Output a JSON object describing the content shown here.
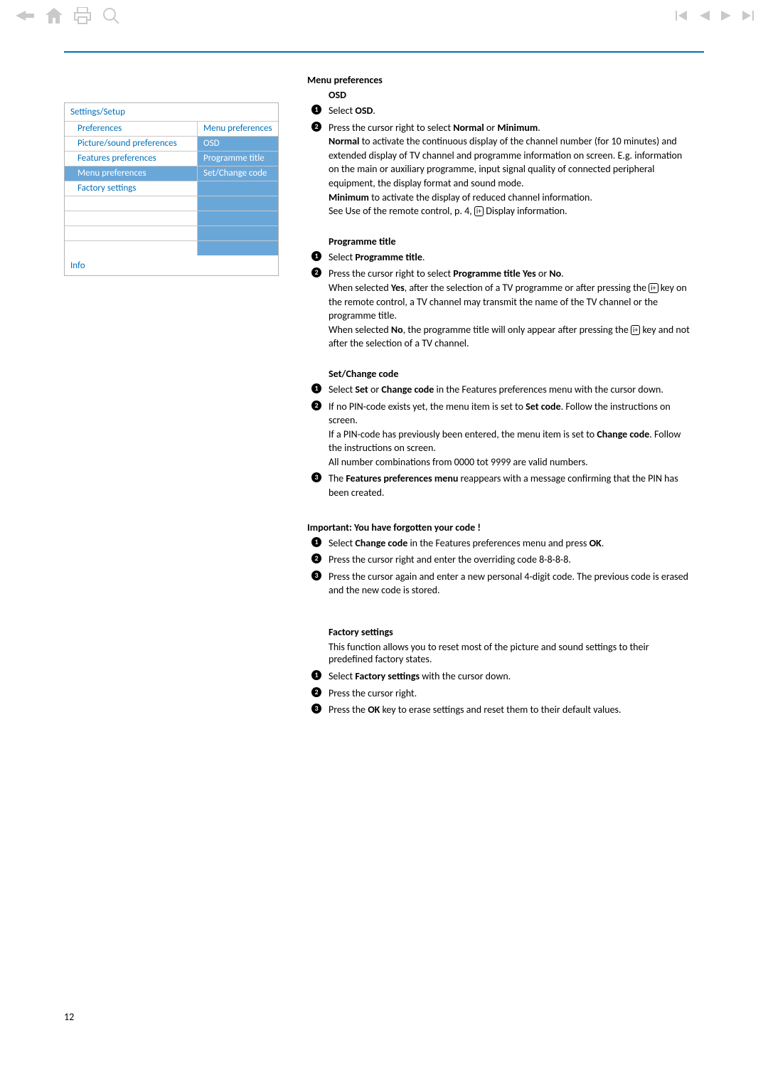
{
  "page_number": "12",
  "menu": {
    "title": "Settings/Setup",
    "col_l_header": "Preferences",
    "col_r_header": "Menu preferences",
    "rows": [
      {
        "l": "Picture/sound preferences",
        "r": "OSD",
        "hl": false,
        "r_white": true
      },
      {
        "l": "Features preferences",
        "r": "Programme title",
        "hl": false,
        "r_white": true
      },
      {
        "l": "Menu preferences",
        "r": "Set/Change code",
        "hl": true,
        "r_white": true
      },
      {
        "l": "Factory settings",
        "r": "",
        "hl": false,
        "r_white": true
      },
      {
        "l": "",
        "r": "",
        "hl": false,
        "r_white": true
      },
      {
        "l": "",
        "r": "",
        "hl": false,
        "r_white": true
      },
      {
        "l": "",
        "r": "",
        "hl": false,
        "r_white": true
      },
      {
        "l": "",
        "r": "",
        "hl": false,
        "r_white": true
      }
    ],
    "info": "Info"
  },
  "sec1": {
    "title": "Menu preferences",
    "sub": "OSD",
    "s1_part1": "Select ",
    "s1_b1": "OSD",
    "s1_part2": ".",
    "s2_part1": "Press the cursor right to select ",
    "s2_b1": "Normal",
    "s2_mid1": " or ",
    "s2_b2": "Minimum",
    "s2_part2": ".",
    "s2_b3": "Normal",
    "s2_tail1": " to activate the continuous display of the channel number (for 10 minutes) and extended display of TV channel and programme information on screen. E.g. information on the main or auxiliary programme, input signal quality of connected peripheral equipment, the display format and sound mode.",
    "s2_b4": "Minimum",
    "s2_tail2": " to activate the display of reduced channel information.",
    "s2_tail3_a": "See Use of the remote control, p. 4, ",
    "s2_tail3_b": " Display information."
  },
  "sec2": {
    "title": "Programme title",
    "s1_a": "Select ",
    "s1_b": "Programme title",
    "s1_c": ".",
    "s2_a": "Press the cursor right to select ",
    "s2_b": "Programme title Yes",
    "s2_c": " or ",
    "s2_d": "No",
    "s2_e": ".",
    "s2_yes_a": "When selected ",
    "s2_yes_b": "Yes",
    "s2_yes_c": ", after the selection of a TV programme or after pressing the ",
    "s2_yes_d": " key on the remote control, a TV channel may transmit the name of the TV channel or the programme title.",
    "s2_no_a": "When selected ",
    "s2_no_b": "No",
    "s2_no_c": ", the programme title will only appear after pressing the ",
    "s2_no_d": " key and not after the selection of a TV channel."
  },
  "sec3": {
    "title": "Set/Change code",
    "s1_a": "Select ",
    "s1_b": "Set",
    "s1_c": " or ",
    "s1_d": "Change code",
    "s1_e": " in the Features preferences menu with the cursor down.",
    "s2_a": "If no PIN-code exists yet, the menu item is set to ",
    "s2_b": "Set code",
    "s2_c": ". Follow the instructions on screen.",
    "s2_d": "If a PIN-code has previously been entered, the menu item is set to ",
    "s2_e": "Change code",
    "s2_f": ". Follow the instructions on screen.",
    "s2_g": "All number combinations from 0000 tot 9999 are valid numbers.",
    "s3_a": "The ",
    "s3_b": "Features preferences menu",
    "s3_c": " reappears with a message confirming that the PIN has been created."
  },
  "sec4": {
    "title": "Important: You have forgotten your code !",
    "s1_a": "Select ",
    "s1_b": "Change code",
    "s1_c": " in the Features preferences menu and press ",
    "s1_d": "OK",
    "s1_e": ".",
    "s2": "Press the cursor right and enter the overriding code 8-8-8-8.",
    "s3": "Press the cursor again and enter a new personal 4-digit code. The previous code is erased and the new code is stored."
  },
  "sec5": {
    "title": "Factory settings",
    "intro": "This function allows you to reset most of the picture and sound settings to their predefined factory states.",
    "s1_a": "Select ",
    "s1_b": "Factory settings",
    "s1_c": " with the cursor down.",
    "s2": "Press the cursor right.",
    "s3_a": "Press the ",
    "s3_b": "OK",
    "s3_c": " key to erase settings and reset them to their default values."
  },
  "iplus_label": "i+"
}
